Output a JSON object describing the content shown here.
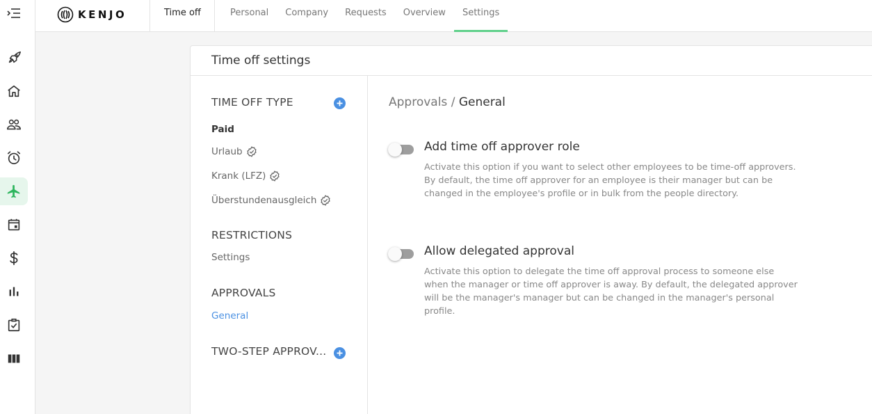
{
  "app": {
    "brand": "KENJO",
    "section": "Time off"
  },
  "rail": {
    "items": [
      {
        "icon": "rocket-icon"
      },
      {
        "icon": "home-icon"
      },
      {
        "icon": "people-icon"
      },
      {
        "icon": "alarm-clock-icon"
      },
      {
        "icon": "airplane-icon",
        "active": true
      },
      {
        "icon": "calendar-icon"
      },
      {
        "icon": "dollar-icon"
      },
      {
        "icon": "bar-chart-icon"
      },
      {
        "icon": "checklist-icon"
      },
      {
        "icon": "columns-icon"
      }
    ]
  },
  "nav": {
    "tabs": [
      "Personal",
      "Company",
      "Requests",
      "Overview",
      "Settings"
    ],
    "active": "Settings"
  },
  "card": {
    "title": "Time off settings"
  },
  "side": {
    "time_off_type": "TIME OFF TYPE",
    "paid": "Paid",
    "types": [
      "Urlaub",
      "Krank (LFZ)",
      "Überstundenausgleich"
    ],
    "restrictions": "RESTRICTIONS",
    "restrictions_item": "Settings",
    "approvals": "APPROVALS",
    "approvals_item": "General",
    "two_step": "TWO-STEP APPROV..."
  },
  "content": {
    "crumb_parent": "Approvals /",
    "crumb_current": "General",
    "options": [
      {
        "title": "Add time off approver role",
        "description": "Activate this option if you want to select other employees to be time-off approvers. By default, the time off approver for an employee is their manager but can be changed in the employee's profile or in bulk from the people directory.",
        "enabled": false
      },
      {
        "title": "Allow delegated approval",
        "description": "Activate this option to delegate the time off approval process to someone else when the manager or time off approver is away. By default, the delegated approver will be the manager's manager but can be changed in the manager's personal profile.",
        "enabled": false
      }
    ]
  },
  "colors": {
    "accent_green": "#5fd08a",
    "link_blue": "#4a90e2",
    "active_icon_green": "#2db55d"
  }
}
